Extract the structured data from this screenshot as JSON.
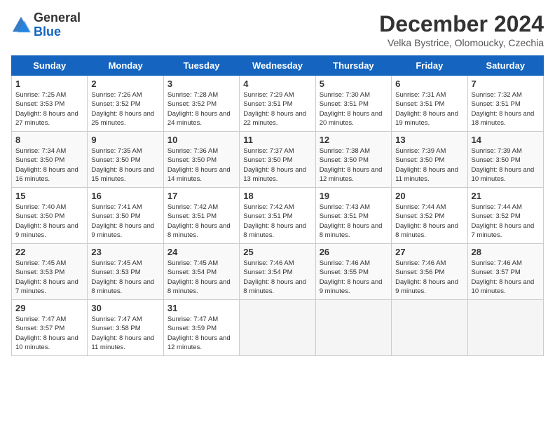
{
  "header": {
    "logo_general": "General",
    "logo_blue": "Blue",
    "month_title": "December 2024",
    "location": "Velka Bystrice, Olomoucky, Czechia"
  },
  "days_of_week": [
    "Sunday",
    "Monday",
    "Tuesday",
    "Wednesday",
    "Thursday",
    "Friday",
    "Saturday"
  ],
  "weeks": [
    [
      {
        "day": "1",
        "sunrise": "Sunrise: 7:25 AM",
        "sunset": "Sunset: 3:53 PM",
        "daylight": "Daylight: 8 hours and 27 minutes."
      },
      {
        "day": "2",
        "sunrise": "Sunrise: 7:26 AM",
        "sunset": "Sunset: 3:52 PM",
        "daylight": "Daylight: 8 hours and 25 minutes."
      },
      {
        "day": "3",
        "sunrise": "Sunrise: 7:28 AM",
        "sunset": "Sunset: 3:52 PM",
        "daylight": "Daylight: 8 hours and 24 minutes."
      },
      {
        "day": "4",
        "sunrise": "Sunrise: 7:29 AM",
        "sunset": "Sunset: 3:51 PM",
        "daylight": "Daylight: 8 hours and 22 minutes."
      },
      {
        "day": "5",
        "sunrise": "Sunrise: 7:30 AM",
        "sunset": "Sunset: 3:51 PM",
        "daylight": "Daylight: 8 hours and 20 minutes."
      },
      {
        "day": "6",
        "sunrise": "Sunrise: 7:31 AM",
        "sunset": "Sunset: 3:51 PM",
        "daylight": "Daylight: 8 hours and 19 minutes."
      },
      {
        "day": "7",
        "sunrise": "Sunrise: 7:32 AM",
        "sunset": "Sunset: 3:51 PM",
        "daylight": "Daylight: 8 hours and 18 minutes."
      }
    ],
    [
      {
        "day": "8",
        "sunrise": "Sunrise: 7:34 AM",
        "sunset": "Sunset: 3:50 PM",
        "daylight": "Daylight: 8 hours and 16 minutes."
      },
      {
        "day": "9",
        "sunrise": "Sunrise: 7:35 AM",
        "sunset": "Sunset: 3:50 PM",
        "daylight": "Daylight: 8 hours and 15 minutes."
      },
      {
        "day": "10",
        "sunrise": "Sunrise: 7:36 AM",
        "sunset": "Sunset: 3:50 PM",
        "daylight": "Daylight: 8 hours and 14 minutes."
      },
      {
        "day": "11",
        "sunrise": "Sunrise: 7:37 AM",
        "sunset": "Sunset: 3:50 PM",
        "daylight": "Daylight: 8 hours and 13 minutes."
      },
      {
        "day": "12",
        "sunrise": "Sunrise: 7:38 AM",
        "sunset": "Sunset: 3:50 PM",
        "daylight": "Daylight: 8 hours and 12 minutes."
      },
      {
        "day": "13",
        "sunrise": "Sunrise: 7:39 AM",
        "sunset": "Sunset: 3:50 PM",
        "daylight": "Daylight: 8 hours and 11 minutes."
      },
      {
        "day": "14",
        "sunrise": "Sunrise: 7:39 AM",
        "sunset": "Sunset: 3:50 PM",
        "daylight": "Daylight: 8 hours and 10 minutes."
      }
    ],
    [
      {
        "day": "15",
        "sunrise": "Sunrise: 7:40 AM",
        "sunset": "Sunset: 3:50 PM",
        "daylight": "Daylight: 8 hours and 9 minutes."
      },
      {
        "day": "16",
        "sunrise": "Sunrise: 7:41 AM",
        "sunset": "Sunset: 3:50 PM",
        "daylight": "Daylight: 8 hours and 9 minutes."
      },
      {
        "day": "17",
        "sunrise": "Sunrise: 7:42 AM",
        "sunset": "Sunset: 3:51 PM",
        "daylight": "Daylight: 8 hours and 8 minutes."
      },
      {
        "day": "18",
        "sunrise": "Sunrise: 7:42 AM",
        "sunset": "Sunset: 3:51 PM",
        "daylight": "Daylight: 8 hours and 8 minutes."
      },
      {
        "day": "19",
        "sunrise": "Sunrise: 7:43 AM",
        "sunset": "Sunset: 3:51 PM",
        "daylight": "Daylight: 8 hours and 8 minutes."
      },
      {
        "day": "20",
        "sunrise": "Sunrise: 7:44 AM",
        "sunset": "Sunset: 3:52 PM",
        "daylight": "Daylight: 8 hours and 8 minutes."
      },
      {
        "day": "21",
        "sunrise": "Sunrise: 7:44 AM",
        "sunset": "Sunset: 3:52 PM",
        "daylight": "Daylight: 8 hours and 7 minutes."
      }
    ],
    [
      {
        "day": "22",
        "sunrise": "Sunrise: 7:45 AM",
        "sunset": "Sunset: 3:53 PM",
        "daylight": "Daylight: 8 hours and 7 minutes."
      },
      {
        "day": "23",
        "sunrise": "Sunrise: 7:45 AM",
        "sunset": "Sunset: 3:53 PM",
        "daylight": "Daylight: 8 hours and 8 minutes."
      },
      {
        "day": "24",
        "sunrise": "Sunrise: 7:45 AM",
        "sunset": "Sunset: 3:54 PM",
        "daylight": "Daylight: 8 hours and 8 minutes."
      },
      {
        "day": "25",
        "sunrise": "Sunrise: 7:46 AM",
        "sunset": "Sunset: 3:54 PM",
        "daylight": "Daylight: 8 hours and 8 minutes."
      },
      {
        "day": "26",
        "sunrise": "Sunrise: 7:46 AM",
        "sunset": "Sunset: 3:55 PM",
        "daylight": "Daylight: 8 hours and 9 minutes."
      },
      {
        "day": "27",
        "sunrise": "Sunrise: 7:46 AM",
        "sunset": "Sunset: 3:56 PM",
        "daylight": "Daylight: 8 hours and 9 minutes."
      },
      {
        "day": "28",
        "sunrise": "Sunrise: 7:46 AM",
        "sunset": "Sunset: 3:57 PM",
        "daylight": "Daylight: 8 hours and 10 minutes."
      }
    ],
    [
      {
        "day": "29",
        "sunrise": "Sunrise: 7:47 AM",
        "sunset": "Sunset: 3:57 PM",
        "daylight": "Daylight: 8 hours and 10 minutes."
      },
      {
        "day": "30",
        "sunrise": "Sunrise: 7:47 AM",
        "sunset": "Sunset: 3:58 PM",
        "daylight": "Daylight: 8 hours and 11 minutes."
      },
      {
        "day": "31",
        "sunrise": "Sunrise: 7:47 AM",
        "sunset": "Sunset: 3:59 PM",
        "daylight": "Daylight: 8 hours and 12 minutes."
      },
      null,
      null,
      null,
      null
    ]
  ]
}
